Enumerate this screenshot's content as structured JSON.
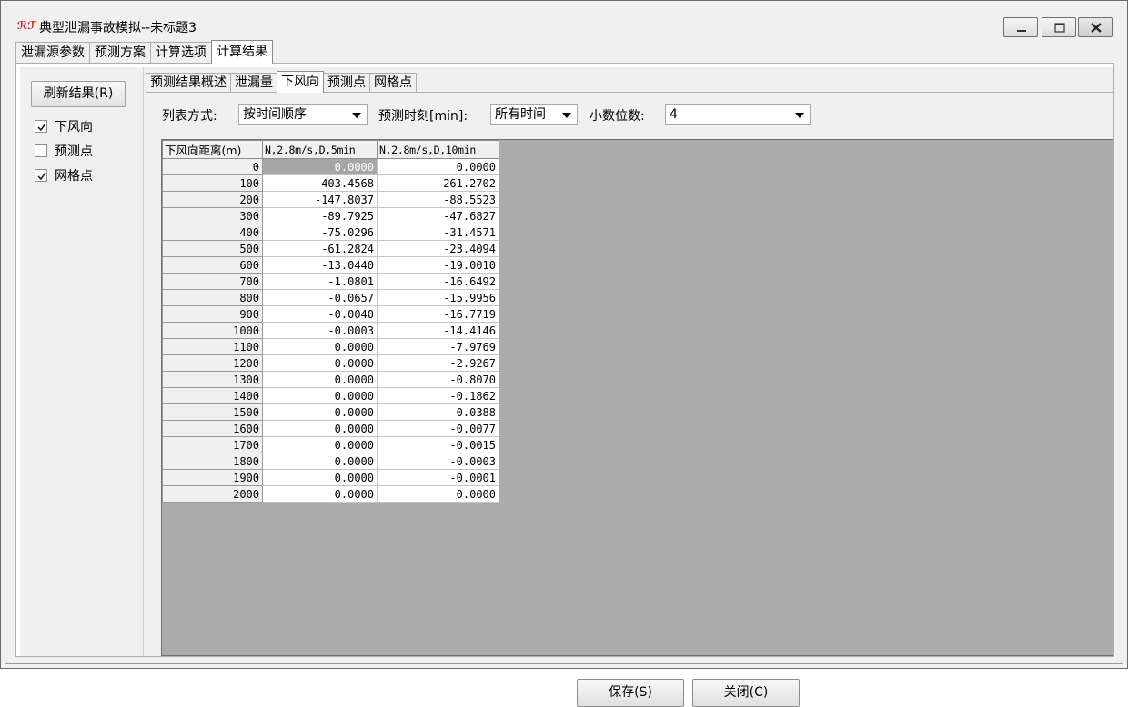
{
  "window": {
    "title": "典型泄漏事故模拟--未标题3",
    "icon": "app-logo-icon",
    "logo_text": "ℛℱ"
  },
  "top_tabs": [
    {
      "label": "泄漏源参数",
      "active": false
    },
    {
      "label": "预测方案",
      "active": false
    },
    {
      "label": "计算选项",
      "active": false
    },
    {
      "label": "计算结果",
      "active": true
    }
  ],
  "left": {
    "refresh_label": "刷新结果(R)",
    "checkboxes": [
      {
        "label": "下风向",
        "checked": true
      },
      {
        "label": "预测点",
        "checked": false
      },
      {
        "label": "网格点",
        "checked": true
      }
    ]
  },
  "sub_tabs": [
    {
      "label": "预测结果概述",
      "active": false
    },
    {
      "label": "泄漏量",
      "active": false
    },
    {
      "label": "下风向",
      "active": true
    },
    {
      "label": "预测点",
      "active": false
    },
    {
      "label": "网格点",
      "active": false
    }
  ],
  "options": {
    "list_mode_label": "列表方式:",
    "list_mode_value": "按时间顺序",
    "time_label": "预测时刻[min]:",
    "time_value": "所有时间",
    "decimals_label": "小数位数:",
    "decimals_value": "4"
  },
  "table": {
    "headers": [
      "下风向距离(m)",
      "N,2.8m/s,D,5min",
      "N,2.8m/s,D,10min"
    ],
    "rows": [
      [
        "0",
        "0.0000",
        "0.0000"
      ],
      [
        "100",
        "-403.4568",
        "-261.2702"
      ],
      [
        "200",
        "-147.8037",
        "-88.5523"
      ],
      [
        "300",
        "-89.7925",
        "-47.6827"
      ],
      [
        "400",
        "-75.0296",
        "-31.4571"
      ],
      [
        "500",
        "-61.2824",
        "-23.4094"
      ],
      [
        "600",
        "-13.0440",
        "-19.0010"
      ],
      [
        "700",
        "-1.0801",
        "-16.6492"
      ],
      [
        "800",
        "-0.0657",
        "-15.9956"
      ],
      [
        "900",
        "-0.0040",
        "-16.7719"
      ],
      [
        "1000",
        "-0.0003",
        "-14.4146"
      ],
      [
        "1100",
        "0.0000",
        "-7.9769"
      ],
      [
        "1200",
        "0.0000",
        "-2.9267"
      ],
      [
        "1300",
        "0.0000",
        "-0.8070"
      ],
      [
        "1400",
        "0.0000",
        "-0.1862"
      ],
      [
        "1500",
        "0.0000",
        "-0.0388"
      ],
      [
        "1600",
        "0.0000",
        "-0.0077"
      ],
      [
        "1700",
        "0.0000",
        "-0.0015"
      ],
      [
        "1800",
        "0.0000",
        "-0.0003"
      ],
      [
        "1900",
        "0.0000",
        "-0.0001"
      ],
      [
        "2000",
        "0.0000",
        "0.0000"
      ]
    ]
  },
  "buttons": {
    "save_label": "保存(S)",
    "close_label": "关闭(C)"
  }
}
